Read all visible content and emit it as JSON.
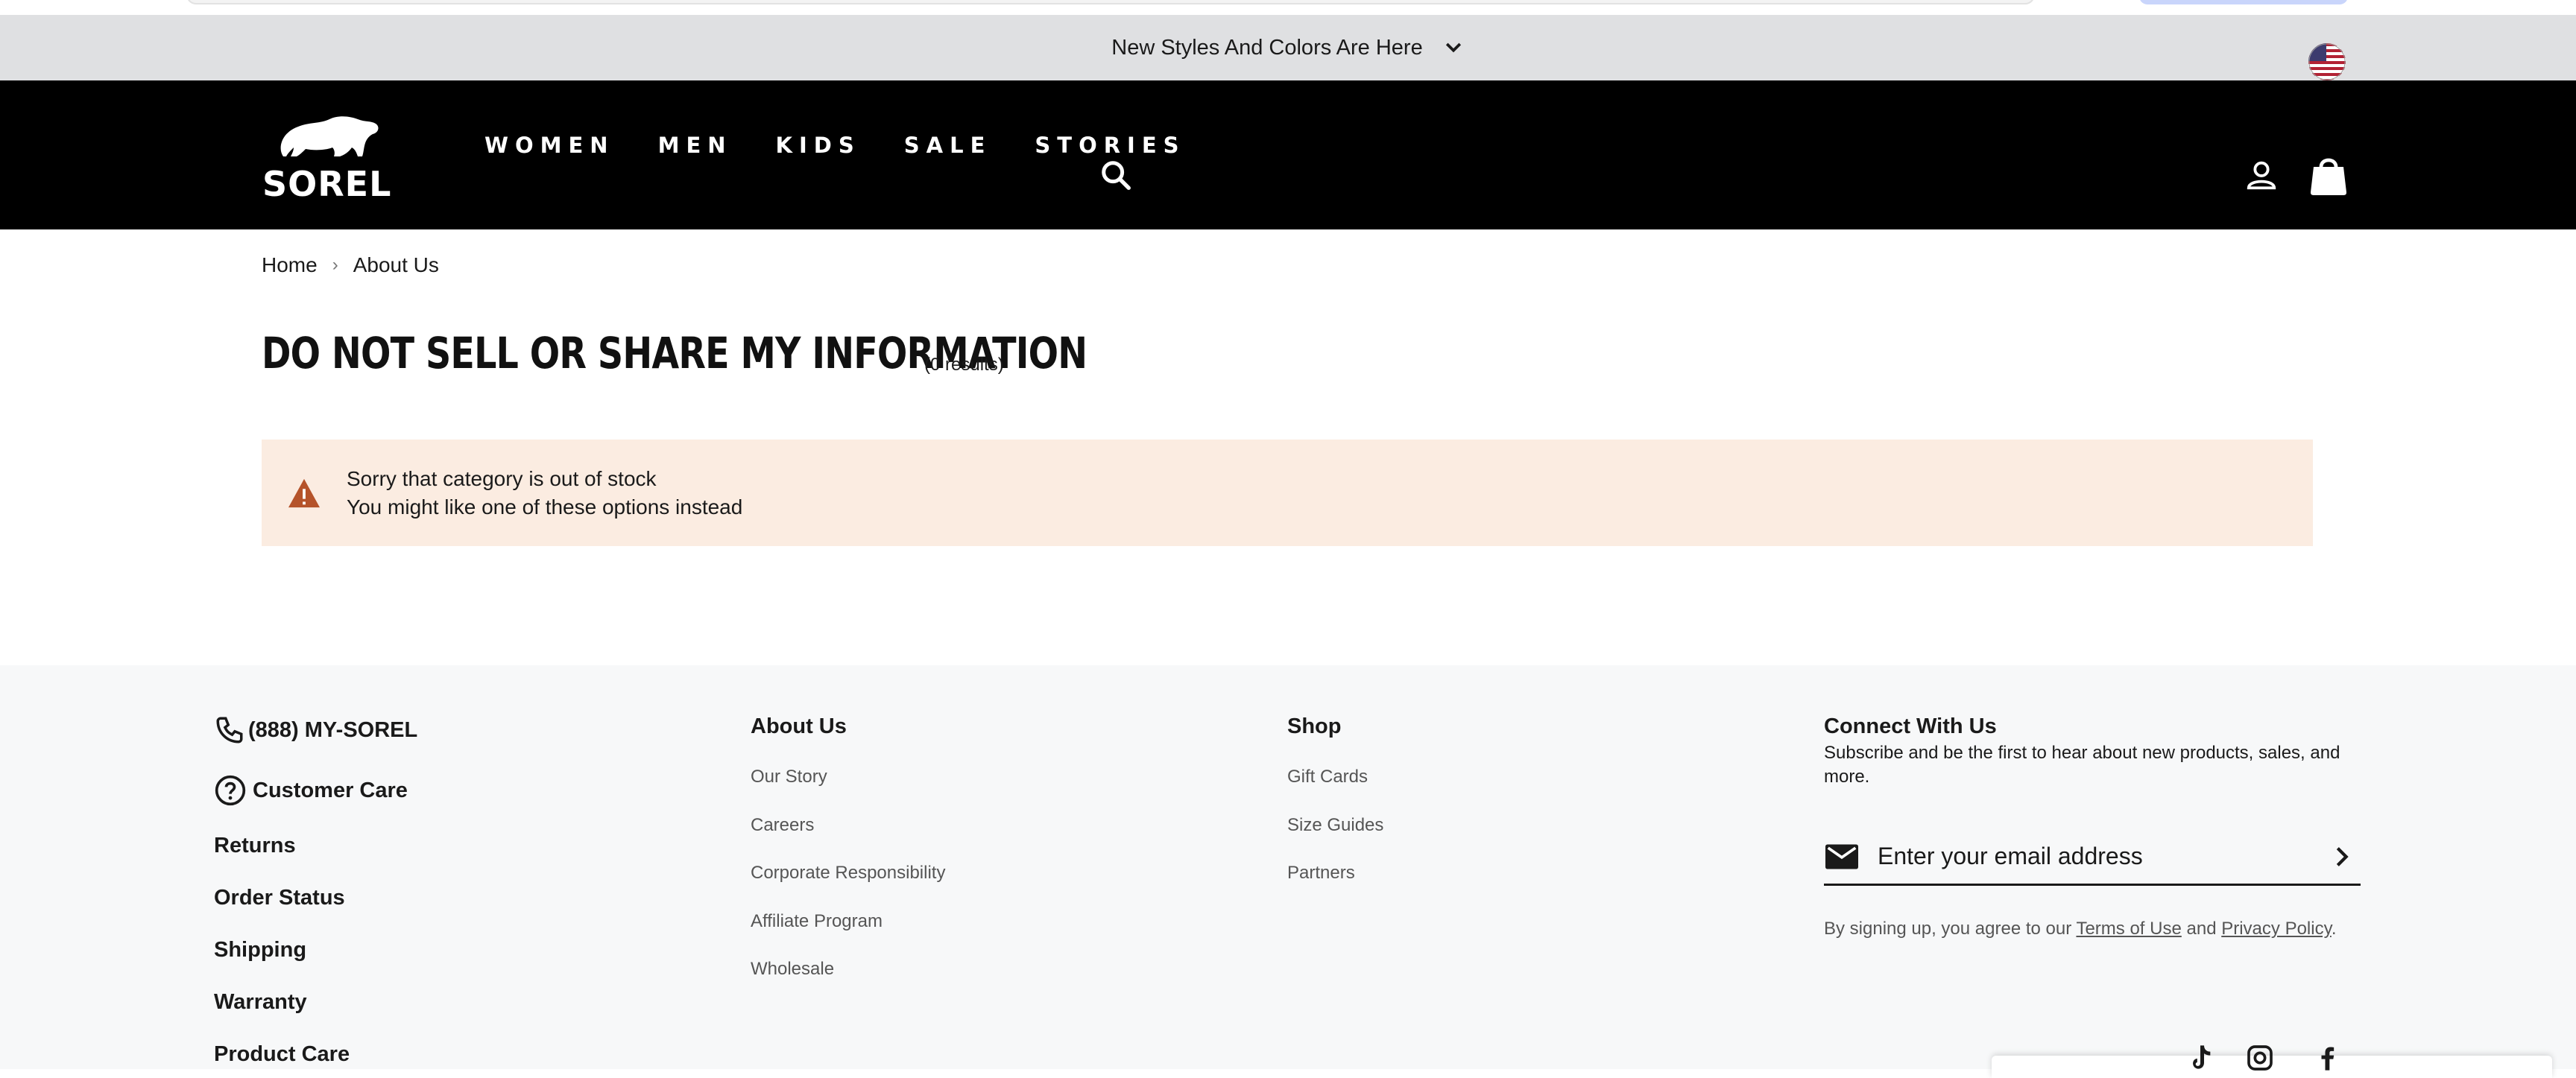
{
  "promo": {
    "text": "New Styles And Colors Are Here"
  },
  "header": {
    "brand": "SOREL",
    "nav": [
      "WOMEN",
      "MEN",
      "KIDS",
      "SALE",
      "STORIES"
    ]
  },
  "breadcrumb": {
    "home": "Home",
    "separator": "›",
    "current": "About Us"
  },
  "page": {
    "title": "DO NOT SELL OR SHARE MY INFORMATION",
    "count": "(0 results)"
  },
  "alert": {
    "line1": "Sorry that category is out of stock",
    "line2": "You might like one of these options instead"
  },
  "footer": {
    "phone": "(888) MY-SOREL",
    "customer_care": "Customer Care",
    "care_links": [
      "Returns",
      "Order Status",
      "Shipping",
      "Warranty",
      "Product Care"
    ],
    "about": {
      "title": "About Us",
      "links": [
        "Our Story",
        "Careers",
        "Corporate Responsibility",
        "Affiliate Program",
        "Wholesale"
      ]
    },
    "shop": {
      "title": "Shop",
      "links": [
        "Gift Cards",
        "Size Guides",
        "Partners"
      ]
    },
    "connect": {
      "title": "Connect With Us",
      "subtitle": "Subscribe and be the first to hear about new products, sales, and more.",
      "email_placeholder": "Enter your email address",
      "legal_prefix": "By signing up, you agree to our ",
      "terms": "Terms of Use",
      "and": " and ",
      "privacy": "Privacy Policy",
      "suffix": "."
    }
  },
  "colors": {
    "header_bg": "#000000",
    "promo_bg": "#dfe0e2",
    "alert_bg": "#fbece1",
    "alert_icon": "#b5532a",
    "footer_bg": "#f7f8f9"
  }
}
